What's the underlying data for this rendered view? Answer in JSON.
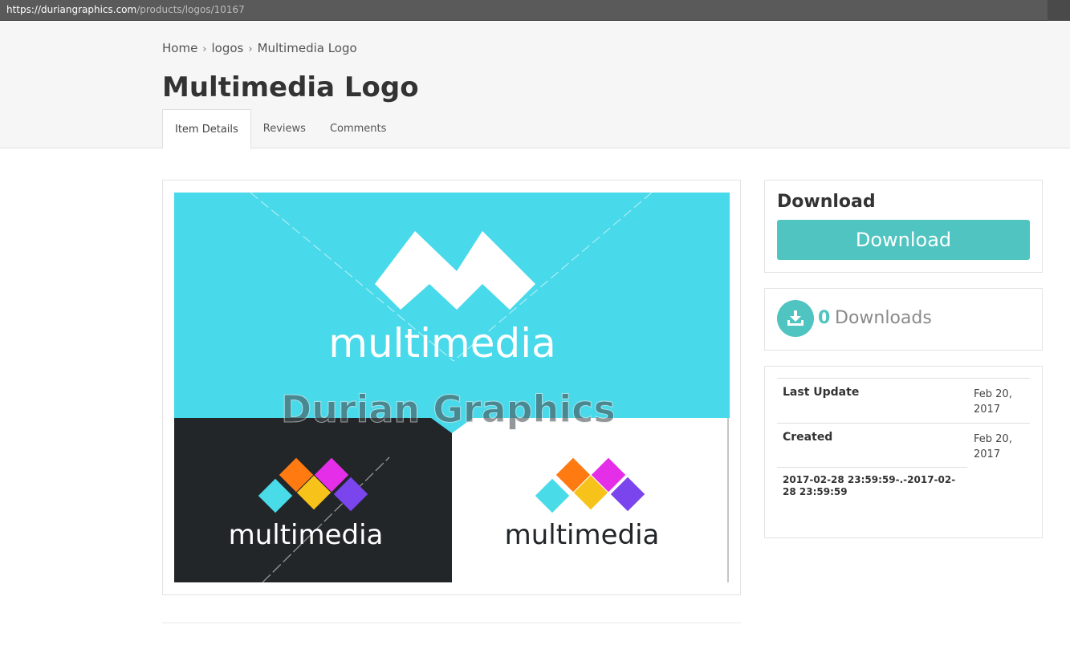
{
  "browser": {
    "url_host": "https://duriangraphics.com",
    "url_path": "/products/logos/10167"
  },
  "breadcrumb": {
    "items": [
      "Home",
      "logos",
      "Multimedia Logo"
    ]
  },
  "page": {
    "title": "Multimedia Logo"
  },
  "tabs": [
    {
      "label": "Item Details",
      "active": true
    },
    {
      "label": "Reviews",
      "active": false
    },
    {
      "label": "Comments",
      "active": false
    }
  ],
  "preview": {
    "logo_word": "multimedia",
    "watermark": "Durian Graphics",
    "colors": {
      "cyan_bg": "#48d9ea",
      "dark_bg": "#222629",
      "light_bg": "#ffffff",
      "tile_cyan": "#49dbe8",
      "tile_orange": "#ff7b12",
      "tile_magenta": "#e52ee7",
      "tile_yellow": "#f7c31b",
      "tile_purple": "#7b45ee"
    }
  },
  "download_card": {
    "heading": "Download",
    "button_label": "Download",
    "accent": "#4fc4c0"
  },
  "downloads": {
    "count": "0",
    "label": "Downloads",
    "icon": "download-tray-icon"
  },
  "info": {
    "rows": [
      {
        "key": "Last Update",
        "value": "Feb 20, 2017"
      },
      {
        "key": "Created",
        "value": "Feb 20, 2017"
      }
    ],
    "range": "2017-02-28 23:59:59-.-2017-02-28 23:59:59"
  }
}
